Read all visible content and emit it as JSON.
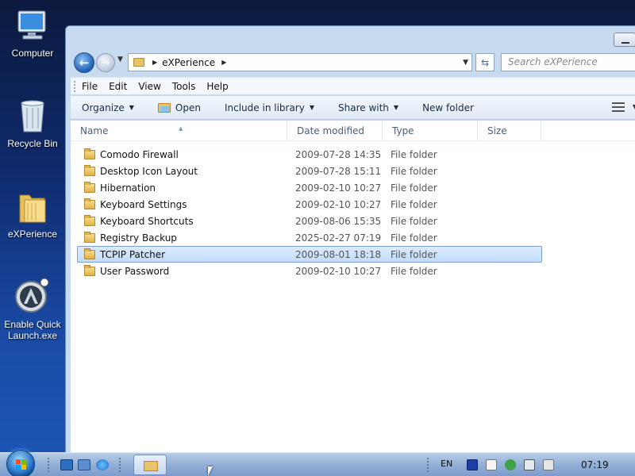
{
  "desktop": {
    "icons": [
      {
        "label": "Computer",
        "icon": "computer-icon"
      },
      {
        "label": "Recycle Bin",
        "icon": "recycle-bin-icon"
      },
      {
        "label": "eXPerience",
        "icon": "folder-icon"
      },
      {
        "label": "Enable Quick Launch.exe",
        "icon": "executable-icon"
      }
    ]
  },
  "explorer": {
    "address": {
      "path": "eXPerience",
      "search_placeholder": "Search eXPerience"
    },
    "menu": [
      "File",
      "Edit",
      "View",
      "Tools",
      "Help"
    ],
    "commands": [
      "Organize",
      "Open",
      "Include in library",
      "Share with",
      "New folder"
    ],
    "columns": [
      "Name",
      "Date modified",
      "Type",
      "Size"
    ],
    "files": [
      {
        "name": "Comodo Firewall",
        "date": "2009-07-28 14:35",
        "type": "File folder"
      },
      {
        "name": "Desktop Icon Layout",
        "date": "2009-07-28 15:11",
        "type": "File folder"
      },
      {
        "name": "Hibernation",
        "date": "2009-02-10 10:27",
        "type": "File folder"
      },
      {
        "name": "Keyboard Settings",
        "date": "2009-02-10 10:27",
        "type": "File folder"
      },
      {
        "name": "Keyboard Shortcuts",
        "date": "2009-08-06 15:35",
        "type": "File folder"
      },
      {
        "name": "Registry Backup",
        "date": "2025-02-27 07:19",
        "type": "File folder"
      },
      {
        "name": "TCPIP Patcher",
        "date": "2009-08-01 18:18",
        "type": "File folder",
        "selected": true
      },
      {
        "name": "User Password",
        "date": "2009-02-10 10:27",
        "type": "File folder"
      }
    ]
  },
  "taskbar": {
    "language": "EN",
    "clock": "07:19"
  },
  "colors": {
    "selection": "#c1dcfb",
    "window_frame": "#c8daf0",
    "taskbar": "#93b0d6"
  }
}
